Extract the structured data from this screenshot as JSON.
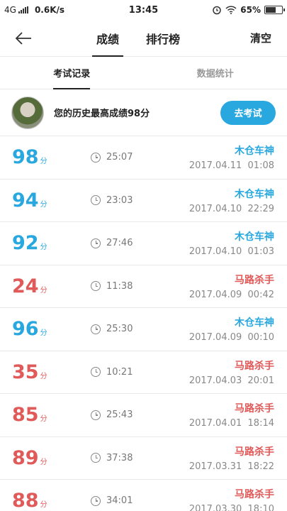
{
  "status": {
    "network": "4G",
    "speed": "0.6K/s",
    "time": "13:45",
    "battery": "65%",
    "battery_level": 0.65
  },
  "nav": {
    "tabs": [
      "成绩",
      "排行榜"
    ],
    "active_tab": 0,
    "clear_label": "清空"
  },
  "subtabs": [
    "考试记录",
    "数据统计"
  ],
  "summary": {
    "text": "您的历史最高成绩98分",
    "button_label": "去考试"
  },
  "colors": {
    "accent": "#29a7df",
    "fail": "#e05a5a"
  },
  "records": [
    {
      "score": "98",
      "unit": "分",
      "duration": "25:07",
      "title": "木仓车神",
      "date": "2017.04.11  01:08",
      "status": "pass"
    },
    {
      "score": "94",
      "unit": "分",
      "duration": "23:03",
      "title": "木仓车神",
      "date": "2017.04.10  22:29",
      "status": "pass"
    },
    {
      "score": "92",
      "unit": "分",
      "duration": "27:46",
      "title": "木仓车神",
      "date": "2017.04.10  01:03",
      "status": "pass"
    },
    {
      "score": "24",
      "unit": "分",
      "duration": "11:38",
      "title": "马路杀手",
      "date": "2017.04.09  00:42",
      "status": "fail"
    },
    {
      "score": "96",
      "unit": "分",
      "duration": "25:30",
      "title": "木仓车神",
      "date": "2017.04.09  00:10",
      "status": "pass"
    },
    {
      "score": "35",
      "unit": "分",
      "duration": "10:21",
      "title": "马路杀手",
      "date": "2017.04.03  20:01",
      "status": "fail"
    },
    {
      "score": "85",
      "unit": "分",
      "duration": "25:43",
      "title": "马路杀手",
      "date": "2017.04.01  18:14",
      "status": "fail"
    },
    {
      "score": "89",
      "unit": "分",
      "duration": "37:38",
      "title": "马路杀手",
      "date": "2017.03.31  18:22",
      "status": "fail"
    },
    {
      "score": "88",
      "unit": "分",
      "duration": "34:01",
      "title": "马路杀手",
      "date": "2017.03.30  18:10",
      "status": "fail"
    }
  ]
}
